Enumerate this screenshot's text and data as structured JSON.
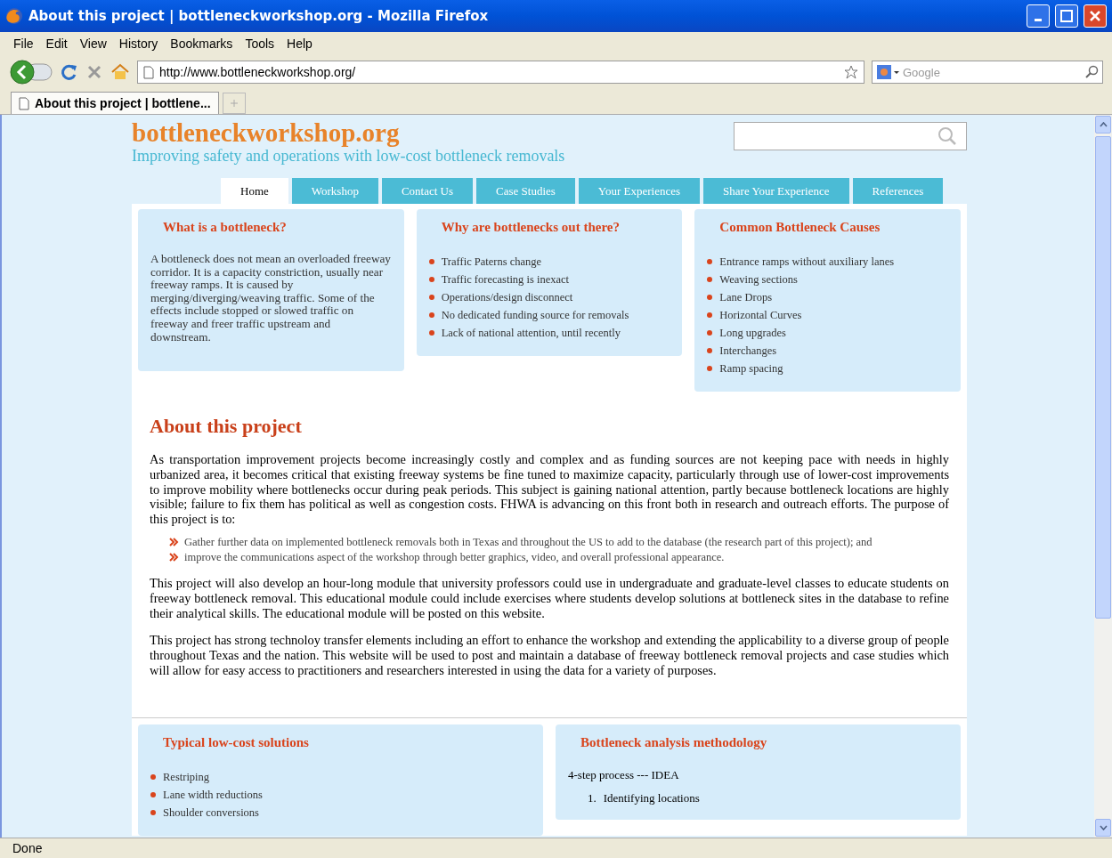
{
  "window": {
    "title": "About this project | bottleneckworkshop.org - Mozilla Firefox"
  },
  "menu": [
    "File",
    "Edit",
    "View",
    "History",
    "Bookmarks",
    "Tools",
    "Help"
  ],
  "address": {
    "value": "http://www.bottleneckworkshop.org/"
  },
  "search": {
    "placeholder": "Google"
  },
  "browser_tabs": [
    {
      "label": "About this project | bottlene...",
      "selected": true
    }
  ],
  "site": {
    "logo": "bottleneckworkshop.org",
    "tagline": "Improving safety and operations with low-cost bottleneck removals",
    "nav": [
      {
        "label": "Home",
        "selected": true
      },
      {
        "label": "Workshop",
        "selected": false
      },
      {
        "label": "Contact Us",
        "selected": false
      },
      {
        "label": "Case Studies",
        "selected": false
      },
      {
        "label": "Your Experiences",
        "selected": false
      },
      {
        "label": "Share Your Experience",
        "selected": false
      },
      {
        "label": "References",
        "selected": false
      }
    ],
    "cards": [
      {
        "title": "What is a bottleneck?",
        "kind": "paragraph",
        "text": "A bottleneck does not mean an overloaded freeway corridor. It is a capacity constriction, usually near freeway ramps. It is caused by merging/diverging/weaving traffic. Some of the effects include stopped or slowed traffic on freeway and freer traffic upstream and downstream."
      },
      {
        "title": "Why are bottlenecks out there?",
        "kind": "bullets",
        "items": [
          "Traffic Paterns change",
          "Traffic forecasting is inexact",
          "Operations/design disconnect",
          "No dedicated funding source for removals",
          "Lack of national attention, until recently"
        ]
      },
      {
        "title": "Common Bottleneck Causes",
        "kind": "bullets",
        "items": [
          "Entrance ramps without auxiliary lanes",
          "Weaving sections",
          "Lane Drops",
          "Horizontal Curves",
          "Long upgrades",
          "Interchanges",
          "Ramp spacing"
        ]
      }
    ],
    "about": {
      "heading": "About this project",
      "intro": "As transportation improvement projects become increasingly costly and complex and as funding sources are not keeping pace with needs in highly urbanized area, it becomes critical that existing freeway systems be fine tuned to maximize capacity, particularly through use of lower-cost improvements to improve mobility where bottlenecks occur during peak periods. This subject is gaining national attention, partly because bottleneck locations are highly visible; failure to fix them has political as well as congestion costs. FHWA is advancing on this front both in research and outreach efforts. The purpose of this project is to:",
      "goals": [
        "Gather further data on implemented bottleneck removals both in Texas and throughout the US to add to the database (the research part of this project); and",
        "improve the communications aspect of the workshop through better graphics, video, and overall professional appearance."
      ],
      "paragraphs": [
        "This project will also develop an hour-long module that university professors could use in undergraduate and graduate-level classes to educate students on freeway bottleneck removal. This educational module could include exercises where students develop solutions at bottleneck sites in the database to refine their analytical skills. The educational module will be posted on this website.",
        "This project has strong technoloy transfer elements including an effort to enhance the workshop and extending the applicability to a diverse group of people throughout Texas and the nation. This website will be used to post and maintain a database of freeway bottleneck removal projects and case studies which will allow for easy access to practitioners and researchers interested in using the data for a variety of purposes."
      ]
    },
    "bottom_cards": [
      {
        "title": "Typical low-cost solutions",
        "kind": "bullets",
        "items": [
          "Restriping",
          "Lane width reductions",
          "Shoulder conversions"
        ]
      },
      {
        "title": "Bottleneck analysis methodology",
        "kind": "steps",
        "lead": "4-step process --- IDEA",
        "items": [
          {
            "number": "1.",
            "text": "Identifying locations"
          }
        ]
      }
    ]
  },
  "status_bar": "Done"
}
